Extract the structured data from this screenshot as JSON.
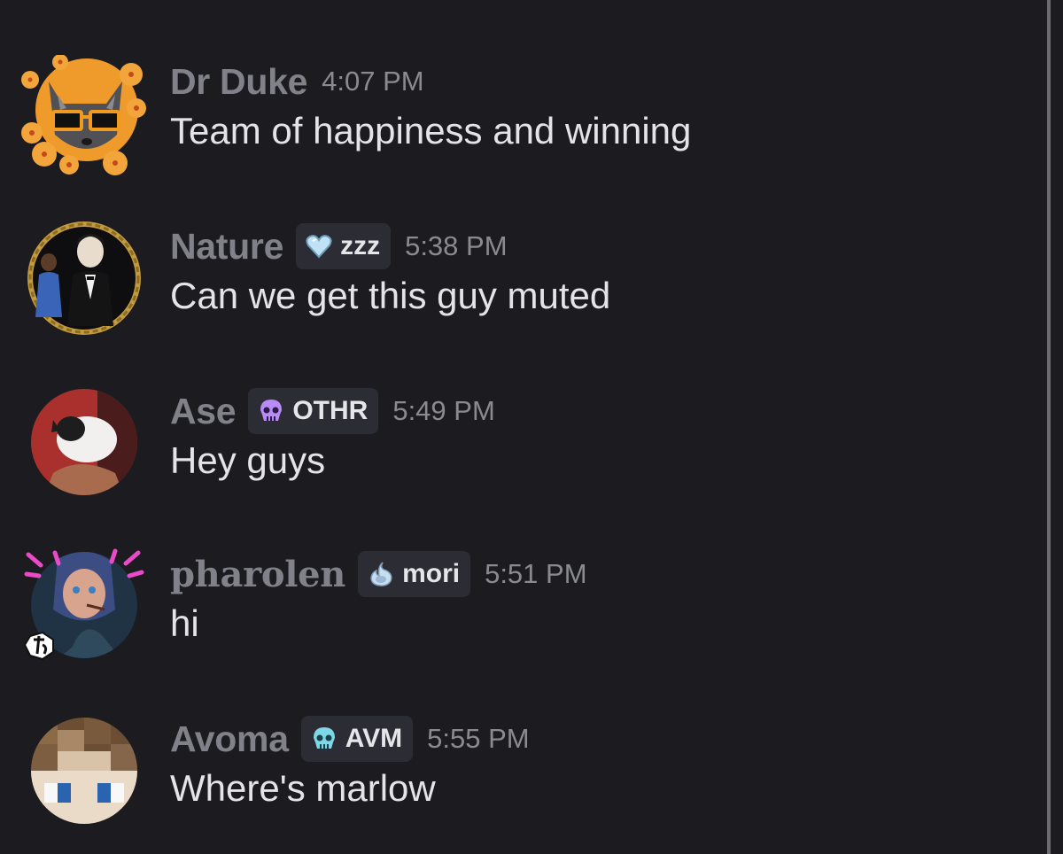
{
  "messages": [
    {
      "username": "Dr Duke",
      "tag": null,
      "tag_icon": null,
      "time": "4:07 PM",
      "text": "Team of happiness and winning"
    },
    {
      "username": "Nature",
      "tag": "zzz",
      "tag_icon": "heart-icon",
      "time": "5:38 PM",
      "text": "Can we get this guy muted"
    },
    {
      "username": "Ase",
      "tag": "OTHR",
      "tag_icon": "skull-icon",
      "time": "5:49 PM",
      "text": "Hey guys"
    },
    {
      "username": "pharolen",
      "tag": "mori",
      "tag_icon": "flame-icon",
      "time": "5:51 PM",
      "text": "hi"
    },
    {
      "username": "Avoma",
      "tag": "AVM",
      "tag_icon": "skull-icon",
      "time": "5:55 PM",
      "text": "Where's marlow"
    }
  ],
  "colors": {
    "background": "#1b1b20",
    "username": "#818189",
    "timestamp": "#8a8a91",
    "message_text": "#e4e4e8",
    "tag_background": "#2c2d34"
  }
}
